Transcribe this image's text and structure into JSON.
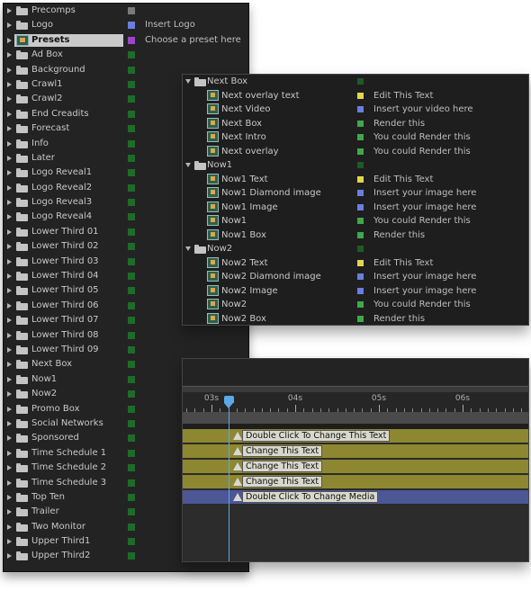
{
  "project": {
    "items": [
      {
        "name": "Precomps",
        "color": "#7a7a7a",
        "comment": ""
      },
      {
        "name": "Logo",
        "color": "#6a7ee0",
        "comment": "Insert Logo"
      },
      {
        "name": "Presets",
        "color": "#9b45c9",
        "comment": "Choose a preset here",
        "selected": true,
        "icon": "comp"
      },
      {
        "name": "Ad Box",
        "color": "#1f6b2a",
        "comment": ""
      },
      {
        "name": "Background",
        "color": "#1f6b2a",
        "comment": ""
      },
      {
        "name": "Crawl1",
        "color": "#1f6b2a",
        "comment": ""
      },
      {
        "name": "Crawl2",
        "color": "#1f6b2a",
        "comment": ""
      },
      {
        "name": "End Creadits",
        "color": "#1f6b2a",
        "comment": ""
      },
      {
        "name": "Forecast",
        "color": "#1f6b2a",
        "comment": ""
      },
      {
        "name": "Info",
        "color": "#1f6b2a",
        "comment": ""
      },
      {
        "name": "Later",
        "color": "#1f6b2a",
        "comment": ""
      },
      {
        "name": "Logo Reveal1",
        "color": "#1f6b2a",
        "comment": ""
      },
      {
        "name": "Logo Reveal2",
        "color": "#1f6b2a",
        "comment": ""
      },
      {
        "name": "Logo Reveal3",
        "color": "#1f6b2a",
        "comment": ""
      },
      {
        "name": "Logo Reveal4",
        "color": "#1f6b2a",
        "comment": ""
      },
      {
        "name": "Lower Third 01",
        "color": "#1f6b2a",
        "comment": ""
      },
      {
        "name": "Lower Third 02",
        "color": "#1f6b2a",
        "comment": ""
      },
      {
        "name": "Lower Third 03",
        "color": "#1f6b2a",
        "comment": ""
      },
      {
        "name": "Lower Third 04",
        "color": "#1f6b2a",
        "comment": ""
      },
      {
        "name": "Lower Third 05",
        "color": "#1f6b2a",
        "comment": ""
      },
      {
        "name": "Lower Third 06",
        "color": "#1f6b2a",
        "comment": ""
      },
      {
        "name": "Lower Third 07",
        "color": "#1f6b2a",
        "comment": ""
      },
      {
        "name": "Lower Third 08",
        "color": "#1f6b2a",
        "comment": ""
      },
      {
        "name": "Lower Third 09",
        "color": "#1f6b2a",
        "comment": ""
      },
      {
        "name": "Next Box",
        "color": "#1f6b2a",
        "comment": ""
      },
      {
        "name": "Now1",
        "color": "#1f6b2a",
        "comment": ""
      },
      {
        "name": "Now2",
        "color": "#1f6b2a",
        "comment": ""
      },
      {
        "name": "Promo Box",
        "color": "#1f6b2a",
        "comment": ""
      },
      {
        "name": "Social Networks",
        "color": "#1f6b2a",
        "comment": ""
      },
      {
        "name": "Sponsored",
        "color": "#1f6b2a",
        "comment": ""
      },
      {
        "name": "Time Schedule 1",
        "color": "#1f6b2a",
        "comment": ""
      },
      {
        "name": "Time Schedule 2",
        "color": "#1f6b2a",
        "comment": ""
      },
      {
        "name": "Time Schedule 3",
        "color": "#1f6b2a",
        "comment": ""
      },
      {
        "name": "Top Ten",
        "color": "#1f6b2a",
        "comment": ""
      },
      {
        "name": "Trailer",
        "color": "#1f6b2a",
        "comment": ""
      },
      {
        "name": "Two Monitor",
        "color": "#1f6b2a",
        "comment": ""
      },
      {
        "name": "Upper Third1",
        "color": "#1f6b2a",
        "comment": ""
      },
      {
        "name": "Upper Third2",
        "color": "#1f6b2a",
        "comment": ""
      }
    ]
  },
  "presets": {
    "groups": [
      {
        "name": "Next Box",
        "color": "#1f5a26",
        "children": [
          {
            "name": "Next overlay text",
            "color": "#e3d64a",
            "comment": "Edit This Text"
          },
          {
            "name": "Next Video",
            "color": "#6a7ee0",
            "comment": "Insert your video here"
          },
          {
            "name": "Next Box",
            "color": "#3ea84a",
            "comment": "Render this"
          },
          {
            "name": "Next Intro",
            "color": "#3ea84a",
            "comment": "You could Render this"
          },
          {
            "name": "Next overlay",
            "color": "#3ea84a",
            "comment": "You could Render this"
          }
        ]
      },
      {
        "name": "Now1",
        "color": "#1f5a26",
        "children": [
          {
            "name": "Now1 Text",
            "color": "#e3d64a",
            "comment": "Edit This Text"
          },
          {
            "name": "Now1 Diamond image",
            "color": "#6a7ee0",
            "comment": "Insert your image here"
          },
          {
            "name": "Now1 Image",
            "color": "#6a7ee0",
            "comment": "Insert your image here"
          },
          {
            "name": "Now1",
            "color": "#3ea84a",
            "comment": "You could Render this"
          },
          {
            "name": "Now1 Box",
            "color": "#3ea84a",
            "comment": "Render this"
          }
        ]
      },
      {
        "name": "Now2",
        "color": "#1f5a26",
        "children": [
          {
            "name": "Now2 Text",
            "color": "#e3d64a",
            "comment": "Edit This Text"
          },
          {
            "name": "Now2 Diamond image",
            "color": "#6a7ee0",
            "comment": "Insert your image here"
          },
          {
            "name": "Now2 Image",
            "color": "#6a7ee0",
            "comment": "Insert your image here"
          },
          {
            "name": "Now2",
            "color": "#3ea84a",
            "comment": "You could Render this"
          },
          {
            "name": "Now2  Box",
            "color": "#3ea84a",
            "comment": "Render this"
          }
        ]
      }
    ]
  },
  "timeline": {
    "ruler": [
      {
        "label": "03s"
      },
      {
        "label": "04s"
      },
      {
        "label": "05s"
      },
      {
        "label": "06s"
      }
    ],
    "layers": [
      {
        "label": "Double Click To Change This Text",
        "type": "text"
      },
      {
        "label": "Change This Text",
        "type": "text"
      },
      {
        "label": "Change This Text",
        "type": "text"
      },
      {
        "label": "Change This Text",
        "type": "text"
      },
      {
        "label": "Double Click To Change Media",
        "type": "media"
      }
    ],
    "playhead_color": "#5aa9e6"
  }
}
